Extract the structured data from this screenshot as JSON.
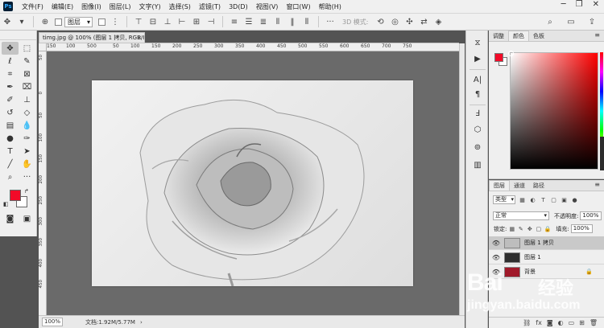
{
  "menubar": {
    "logo": "Ps",
    "items": [
      "文件(F)",
      "编辑(E)",
      "图像(I)",
      "图层(L)",
      "文字(Y)",
      "选择(S)",
      "滤镜(T)",
      "3D(D)",
      "视图(V)",
      "窗口(W)",
      "帮助(H)"
    ]
  },
  "options": {
    "layer_select": "图层",
    "mode_3d": "3D 模式:"
  },
  "document": {
    "tab_title": "timg.jpg @ 100% (图层 1 拷贝, RGB/8#) *",
    "close": "×",
    "ruler_ticks": [
      "150",
      "100",
      "50",
      "0",
      "50",
      "100",
      "150",
      "200",
      "250",
      "300",
      "350",
      "400",
      "450",
      "500",
      "550",
      "600",
      "650",
      "700",
      "750"
    ],
    "zoom": "100%",
    "doc_info": "文档:1.92M/5.77M",
    "status_arrow": "›"
  },
  "color_panel": {
    "tabs": [
      "调整",
      "颜色",
      "色板"
    ],
    "active_tab": 1,
    "foreground": "#f20a28",
    "background": "#ffffff"
  },
  "layers_panel": {
    "tabs": [
      "图层",
      "通道",
      "路径"
    ],
    "active_tab": 0,
    "kind_filter": "类型",
    "blend_mode": "正常",
    "opacity_label": "不透明度:",
    "opacity": "100%",
    "lock_label": "锁定:",
    "fill_label": "填充:",
    "fill": "100%",
    "layers": [
      {
        "name": "图层 1 拷贝",
        "selected": true
      },
      {
        "name": "图层 1",
        "selected": false
      },
      {
        "name": "背景",
        "selected": false
      }
    ]
  },
  "watermark": {
    "brand": "Bai",
    "brand_cn": "经验",
    "url": "jingyan.baidu.com"
  }
}
